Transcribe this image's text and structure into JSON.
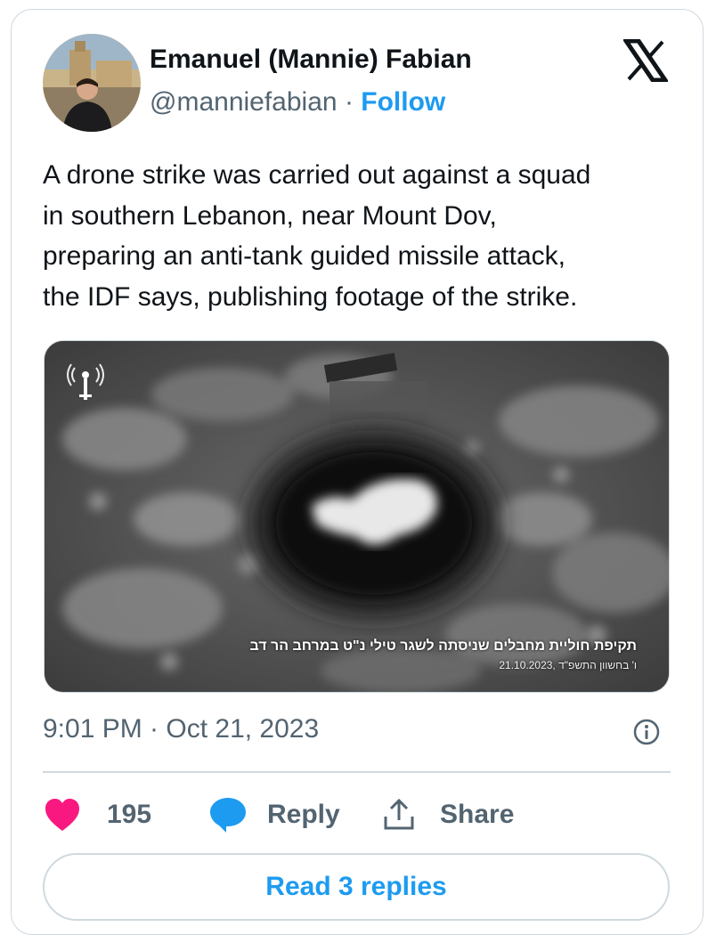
{
  "author": {
    "name": "Emanuel (Mannie) Fabian",
    "handle": "@manniefabian",
    "separator": "·",
    "follow_label": "Follow"
  },
  "tweet": {
    "text_lines": [
      "A drone strike was carried out against a squad",
      "in southern Lebanon, near Mount Dov,",
      "preparing an anti-tank guided missile attack,",
      "the IDF says, publishing footage of the strike."
    ]
  },
  "media": {
    "caption_main": "תקיפת חוליית מחבלים שניסתה לשגר טילי נ\"ט במרחב הר דב",
    "caption_date": "ו' בחשוון התשפ\"ד ,21.10.2023"
  },
  "timestamp": "9:01 PM · Oct 21, 2023",
  "actions": {
    "like_count": "195",
    "reply_label": "Reply",
    "share_label": "Share"
  },
  "read_replies_label": "Read 3 replies",
  "colors": {
    "accent": "#1d9bf0",
    "like": "#f91880",
    "text": "#0f1419",
    "secondary": "#536471",
    "border": "#cfd9de"
  },
  "icons": {
    "platform": "x-logo-icon",
    "like": "heart-icon",
    "reply": "speech-bubble-icon",
    "share": "share-upload-icon",
    "info": "info-icon"
  }
}
